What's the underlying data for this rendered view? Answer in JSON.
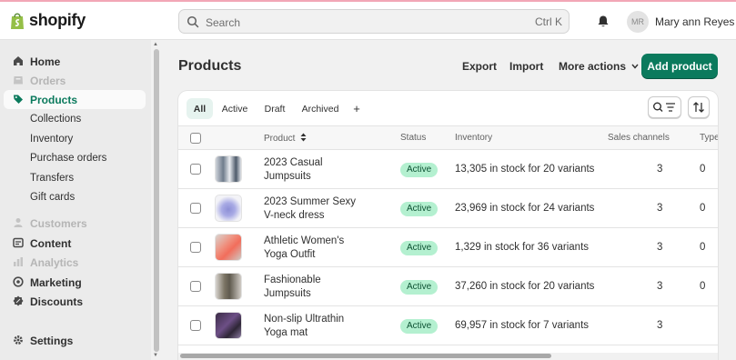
{
  "app": {
    "logo_text": "shopify"
  },
  "search": {
    "placeholder": "Search",
    "shortcut": "Ctrl K"
  },
  "user": {
    "initials": "MR",
    "name": "Mary ann Reyes"
  },
  "sidebar": {
    "items": [
      {
        "label": "Home",
        "icon": "home-icon"
      },
      {
        "label": "Orders",
        "icon": "orders-icon"
      },
      {
        "label": "Products",
        "icon": "tag-icon"
      },
      {
        "label": "Collections"
      },
      {
        "label": "Inventory"
      },
      {
        "label": "Purchase orders"
      },
      {
        "label": "Transfers"
      },
      {
        "label": "Gift cards"
      },
      {
        "label": "Customers",
        "icon": "person-icon"
      },
      {
        "label": "Content",
        "icon": "content-icon"
      },
      {
        "label": "Analytics",
        "icon": "analytics-icon"
      },
      {
        "label": "Marketing",
        "icon": "marketing-icon"
      },
      {
        "label": "Discounts",
        "icon": "discount-icon"
      },
      {
        "label": "Settings",
        "icon": "gear-icon"
      }
    ]
  },
  "page": {
    "title": "Products",
    "export_label": "Export",
    "import_label": "Import",
    "more_label": "More actions",
    "add_label": "Add product"
  },
  "tabs": [
    "All",
    "Active",
    "Draft",
    "Archived",
    "+"
  ],
  "table": {
    "headers": {
      "product": "Product",
      "status": "Status",
      "inventory": "Inventory",
      "channels": "Sales channels",
      "type": "Type"
    },
    "rows": [
      {
        "name": "2023 Casual Jumpsuits",
        "status": "Active",
        "inventory": "13,305 in stock for 20 variants",
        "channels": "3",
        "type": "0"
      },
      {
        "name": "2023 Summer Sexy V-neck dress",
        "status": "Active",
        "inventory": "23,969 in stock for 24 variants",
        "channels": "3",
        "type": "0"
      },
      {
        "name": "Athletic Women's Yoga Outfit",
        "status": "Active",
        "inventory": "1,329 in stock for 36 variants",
        "channels": "3",
        "type": "0"
      },
      {
        "name": "Fashionable Jumpsuits",
        "status": "Active",
        "inventory": "37,260 in stock for 20 variants",
        "channels": "3",
        "type": "0"
      },
      {
        "name": "Non-slip Ultrathin Yoga mat",
        "status": "Active",
        "inventory": "69,957 in stock for 7 variants",
        "channels": "3",
        "type": ""
      }
    ]
  },
  "colors": {
    "primary": "#0b7a5d",
    "active_badge": "#b4f0d0",
    "active_badge_text": "#0c5132"
  }
}
